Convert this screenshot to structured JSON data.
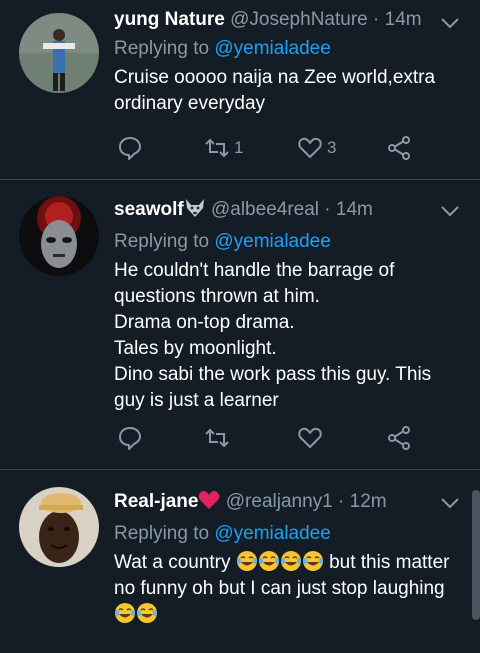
{
  "tweets": [
    {
      "name": "yung Nature",
      "handle": "@JosephNature",
      "time": "14m",
      "replying_prefix": "Replying to",
      "replying_to": "@yemialadee",
      "lines": [
        "Cruise ooooo naija na Zee world,extra",
        "ordinary everyday"
      ],
      "retweets": "1",
      "likes": "3"
    },
    {
      "name": "seawolf",
      "handle": "@albee4real",
      "time": "14m",
      "replying_prefix": "Replying to",
      "replying_to": "@yemialadee",
      "lines": [
        "He couldn't handle the barrage of",
        "questions thrown at him.",
        "Drama on-top drama.",
        "Tales by moonlight.",
        "Dino sabi the work pass this guy. This",
        "guy is just a learner"
      ],
      "retweets": "",
      "likes": ""
    },
    {
      "name": "Real-jane",
      "handle": "@realjanny1",
      "time": "12m",
      "replying_prefix": "Replying to",
      "replying_to": "@yemialadee",
      "line1_start": "Wat a country",
      "line1_end": "but this matter",
      "line2": "no funny oh but I can just stop laughing"
    }
  ],
  "separator": "·",
  "icons": {
    "reply": "speech-bubble-icon",
    "retweet": "retweet-arrows-icon",
    "like": "heart-icon",
    "share": "share-nodes-icon",
    "menu": "chevron-down-icon",
    "badge_wolf": "wolf-face-emoji",
    "badge_heart": "red-heart-emoji",
    "laugh": "face-with-tears-of-joy-emoji"
  },
  "colors": {
    "background": "#141d26",
    "secondary_text": "#8899a6",
    "link": "#1da1f2",
    "heart": "#e0245e"
  }
}
